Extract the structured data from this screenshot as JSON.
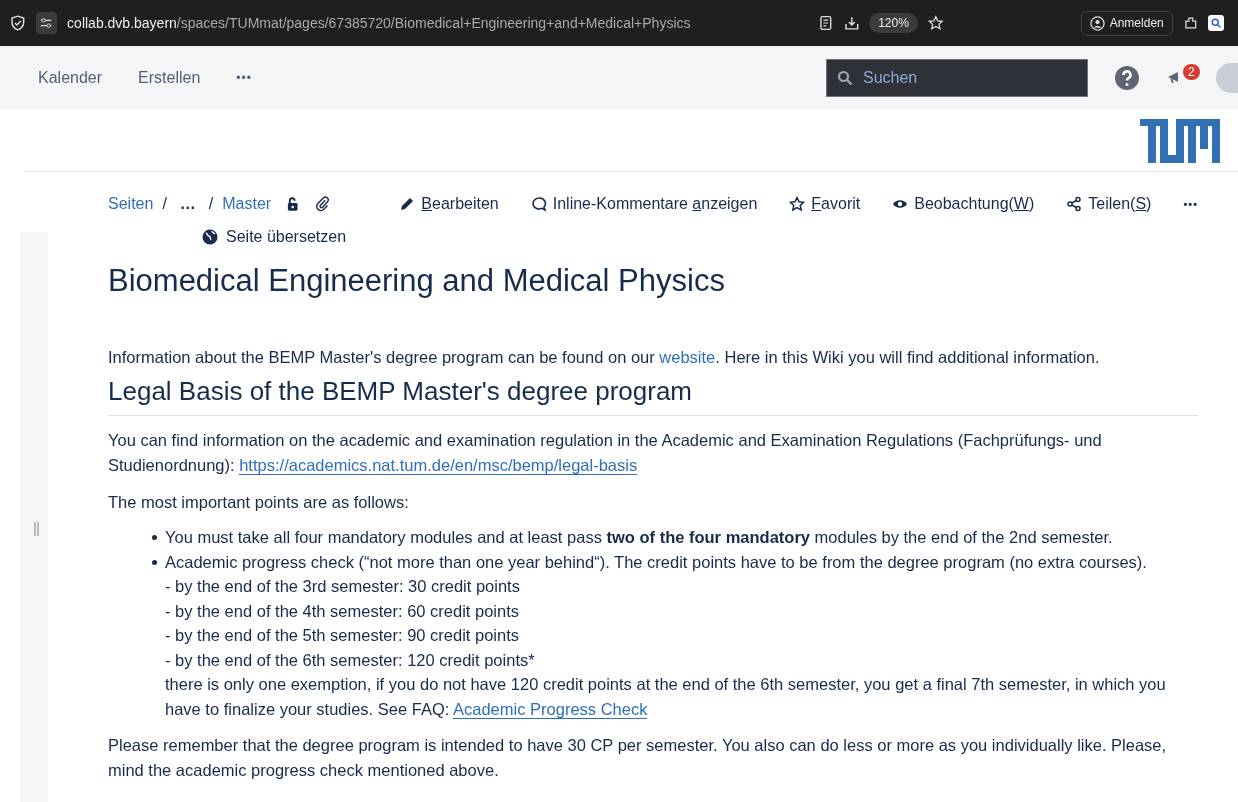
{
  "browser": {
    "url_host": "collab.dvb.bayern",
    "url_path": "/spaces/TUMmat/pages/67385720/Biomedical+Engineering+and+Medical+Physics",
    "zoom": "120%",
    "sign_in": "Anmelden"
  },
  "header": {
    "nav": [
      "Kalender",
      "Erstellen"
    ],
    "more": "•••",
    "search": {
      "placeholder": "Suchen"
    },
    "notifications": "2"
  },
  "breadcrumbs": [
    {
      "label": "Seiten",
      "kind": "link",
      "sep": "/"
    },
    {
      "label": "…",
      "kind": "ellipsis",
      "sep": "/"
    },
    {
      "label": "Master",
      "kind": "link"
    }
  ],
  "actions": [
    {
      "kind": "edit",
      "key": "B",
      "post": "earbeiten"
    },
    {
      "kind": "comment",
      "pre": "Inline-Kommentare ",
      "key": "a",
      "post": "nzeigen"
    },
    {
      "kind": "star",
      "key": "F",
      "post": "avorit"
    },
    {
      "kind": "eye",
      "pre": "Beobachtung(",
      "key": "W",
      "post": ")"
    },
    {
      "kind": "share",
      "pre": "Teilen(",
      "key": "S",
      "post": ")"
    }
  ],
  "actions_more": "•••",
  "translate": "Seite übersetzen",
  "title": "Biomedical Engineering and Medical Physics",
  "intro": {
    "before": "Information about the BEMP Master's degree program can be found on our ",
    "link": "website",
    "after": ". Here in this Wiki you will find additional information."
  },
  "section_heading": "Legal Basis of the BEMP Master's degree program",
  "legal": {
    "text": "You can find information on the academic and examination regulation in the Academic and Examination Regulations (Fachprüfungs- und Studienordnung): ",
    "link": "https://academics.nat.tum.de/en/msc/bemp/legal-basis"
  },
  "points_intro": "The most important points are as follows:",
  "bullets": [
    {
      "text": "You must take all four mandatory modules and at least pass **two of the four mandatory** modules by the end of the 2nd semester."
    },
    {
      "text": "Academic progress check (“not more than one year behind“). The credit points have to be from the degree program (no extra courses).",
      "lines": [
        "- by the end of the 3rd semester: 30 credit points",
        "- by the end of the 4th semester: 60 credit points",
        "- by the end of the 5th semester: 90 credit points",
        "- by the end of the 6th semester: 120 credit points*"
      ],
      "note": "there is only one exemption, if you do not have 120 credit points at the end of the 6th semester, you get a final 7th semester, in which you have to finalize your studies. See FAQ: ",
      "note_link": "Academic Progress Check"
    }
  ],
  "closing": "Please remember that the degree program is intended to have 30 CP per semester. You also can do less or more as you individually like. Please, mind the academic progress check mentioned above."
}
